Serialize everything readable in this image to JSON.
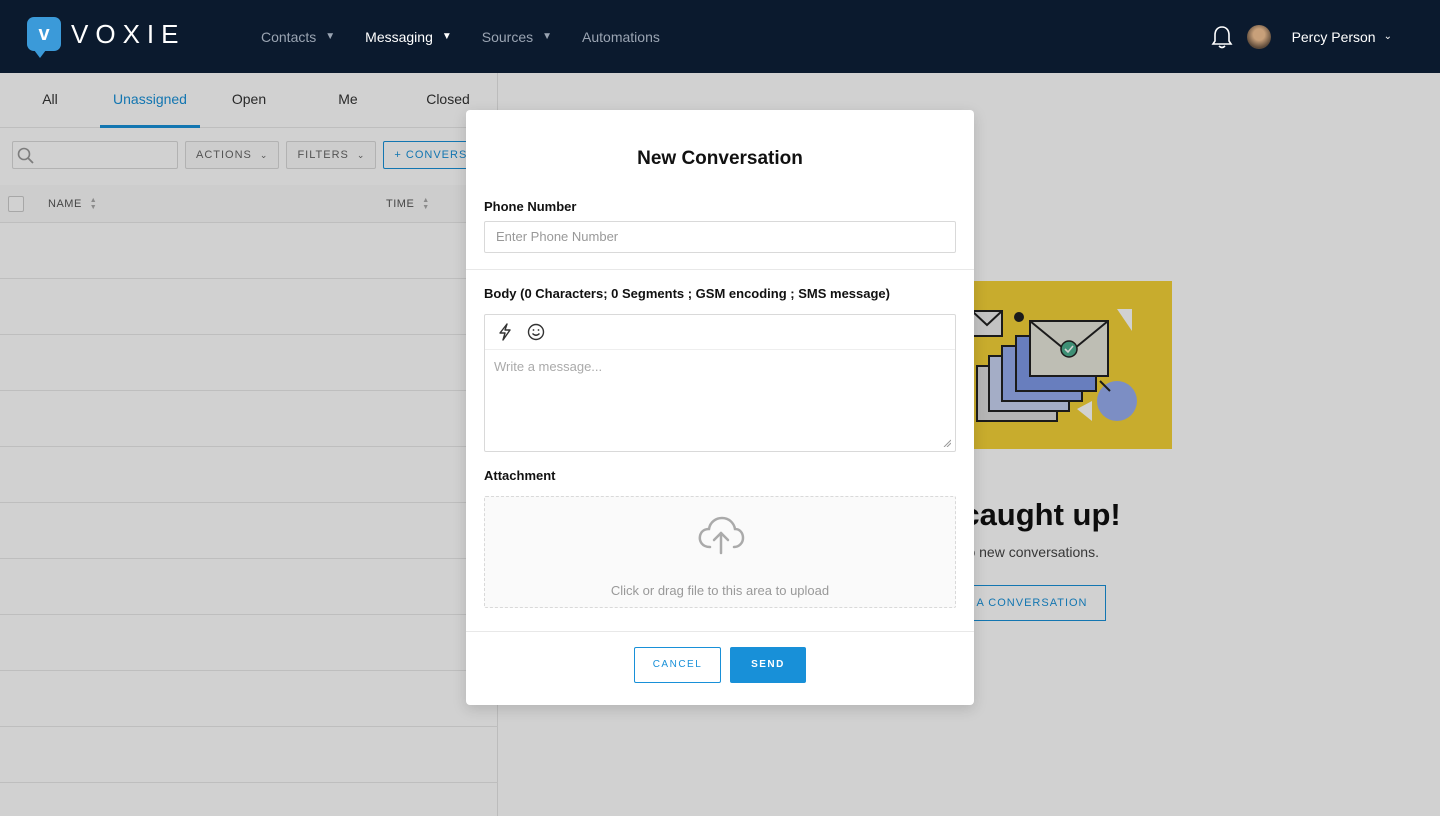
{
  "brand": {
    "name": "VOXIE",
    "accent": "#1890d8",
    "nav_bg": "#0b1a2e"
  },
  "nav": {
    "items": [
      {
        "label": "Contacts",
        "has_menu": true,
        "active": false
      },
      {
        "label": "Messaging",
        "has_menu": true,
        "active": true
      },
      {
        "label": "Sources",
        "has_menu": true,
        "active": false
      },
      {
        "label": "Automations",
        "has_menu": false,
        "active": false
      }
    ],
    "user_name": "Percy Person",
    "notification_icon": "bell-icon"
  },
  "conversations": {
    "tabs": [
      {
        "label": "All",
        "active": false
      },
      {
        "label": "Unassigned",
        "active": true
      },
      {
        "label": "Open",
        "active": false
      },
      {
        "label": "Me",
        "active": false
      },
      {
        "label": "Closed",
        "active": false
      }
    ],
    "search": {
      "placeholder": ""
    },
    "actions_label": "ACTIONS",
    "filters_label": "FILTERS",
    "new_conversation_label": "+ CONVERSATIO",
    "columns": {
      "name": "NAME",
      "time": "TIME"
    }
  },
  "empty_state": {
    "title": "all caught up!",
    "subtitle": "ve no new conversations.",
    "button_label": "ART A CONVERSATION"
  },
  "modal": {
    "title": "New Conversation",
    "phone_label": "Phone Number",
    "phone_placeholder": "Enter Phone Number",
    "phone_value": "",
    "body_label": "Body (0 Characters; 0 Segments ; GSM encoding ; SMS message)",
    "body_placeholder": "Write a message...",
    "attachment_label": "Attachment",
    "upload_text": "Click or drag file to this area to upload",
    "cancel_label": "CANCEL",
    "send_label": "SEND"
  }
}
